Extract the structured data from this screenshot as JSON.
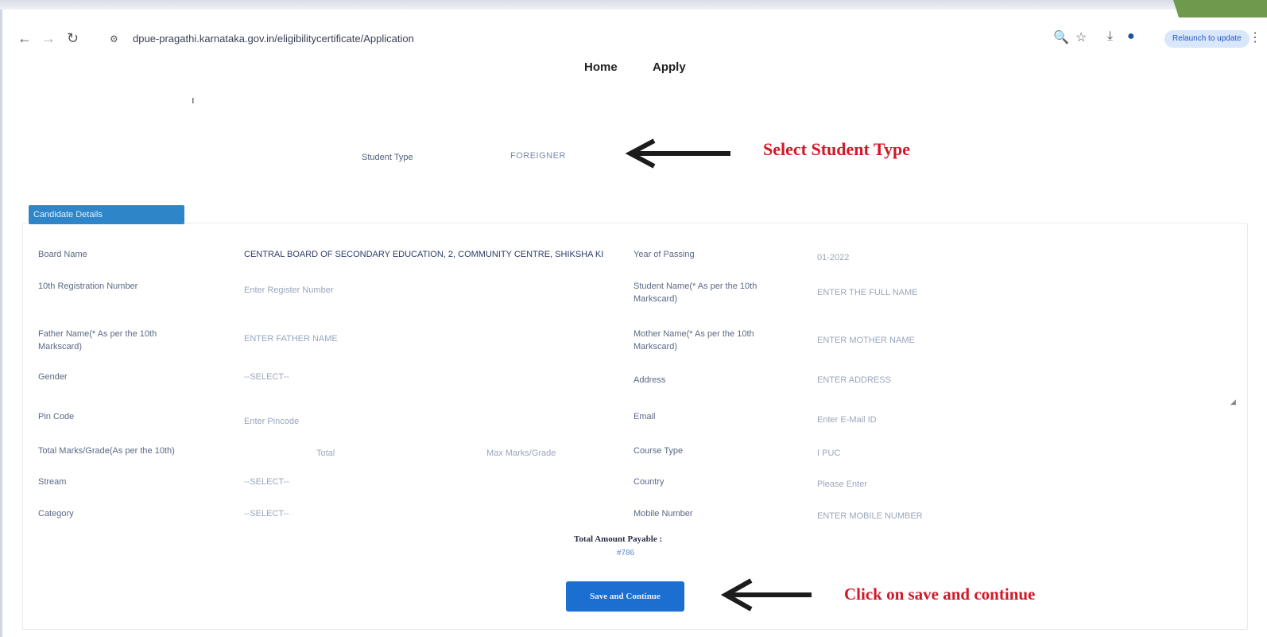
{
  "browser": {
    "url": "dpue-pragathi.karnataka.gov.in/eligibilitycertificate/Application",
    "relaunch_label": "Relaunch to update"
  },
  "nav": {
    "home": "Home",
    "apply": "Apply"
  },
  "student_type": {
    "label": "Student Type",
    "value": "FOREIGNER"
  },
  "annotations": {
    "select_student_type": "Select Student Type",
    "click_save": "Click on save and continue"
  },
  "candidate": {
    "header": "Candidate Details",
    "fields_left": [
      {
        "label": "Board Name",
        "value": "CENTRAL BOARD OF SECONDARY EDUCATION, 2, COMMUNITY CENTRE, SHIKSHA KI"
      },
      {
        "label": "10th Registration Number",
        "value": "Enter Register Number"
      },
      {
        "label": "Father Name(* As per the 10th Markscard)",
        "value": "ENTER FATHER NAME"
      },
      {
        "label": "Gender",
        "value": "--SELECT--"
      },
      {
        "label": "Pin Code",
        "value": "Enter Pincode"
      },
      {
        "label": "Total Marks/Grade(As per the 10th)",
        "value": "Total",
        "value2": "Max Marks/Grade"
      },
      {
        "label": "Stream",
        "value": "--SELECT--"
      },
      {
        "label": "Category",
        "value": "--SELECT--"
      }
    ],
    "fields_right": [
      {
        "label": "Year of Passing",
        "value": "01-2022"
      },
      {
        "label": "Student Name(* As per the 10th Markscard)",
        "value": "ENTER THE FULL NAME"
      },
      {
        "label": "Mother Name(* As per the 10th Markscard)",
        "value": "ENTER MOTHER NAME"
      },
      {
        "label": "Address",
        "value": "ENTER ADDRESS"
      },
      {
        "label": "Email",
        "value": "Enter E-Mail ID"
      },
      {
        "label": "Course Type",
        "value": "I PUC"
      },
      {
        "label": "Country",
        "value": "Please Enter"
      },
      {
        "label": "Mobile Number",
        "value": "ENTER MOBILE NUMBER"
      }
    ],
    "total_label": "Total Amount Payable :",
    "total_amount": "#786",
    "save_label": "Save and Continue"
  }
}
